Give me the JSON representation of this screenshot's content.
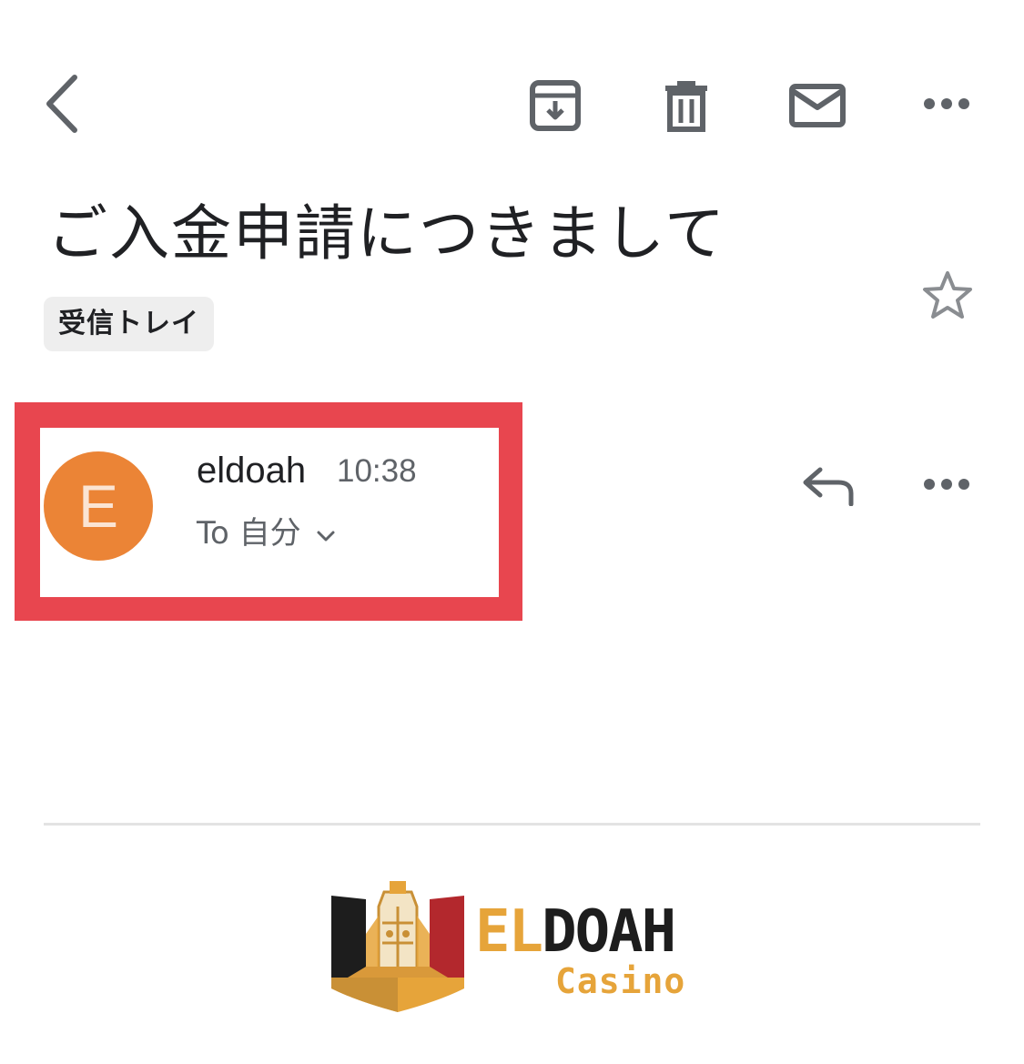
{
  "toolbar": {
    "back_icon": "chevron-left-icon",
    "archive_icon": "archive-icon",
    "delete_icon": "trash-icon",
    "mark_unread_icon": "mail-icon",
    "more_icon": "more-horizontal-icon",
    "icon_color": "#5f6368"
  },
  "message": {
    "subject": "ご入金申請につきまして",
    "label": "受信トレイ",
    "starred": false,
    "sender": {
      "avatar_letter": "E",
      "avatar_color": "#eb8436",
      "name": "eldoah",
      "time": "10:38",
      "recipient": "To 自分"
    },
    "highlight_color": "#e8464f"
  },
  "body": {
    "logo": {
      "word_part1": "EL",
      "word_part2": "DOAH",
      "subtitle": "Casino",
      "gold": "#e6a43a",
      "dark": "#1d1d1d",
      "red": "#b3282d"
    }
  }
}
